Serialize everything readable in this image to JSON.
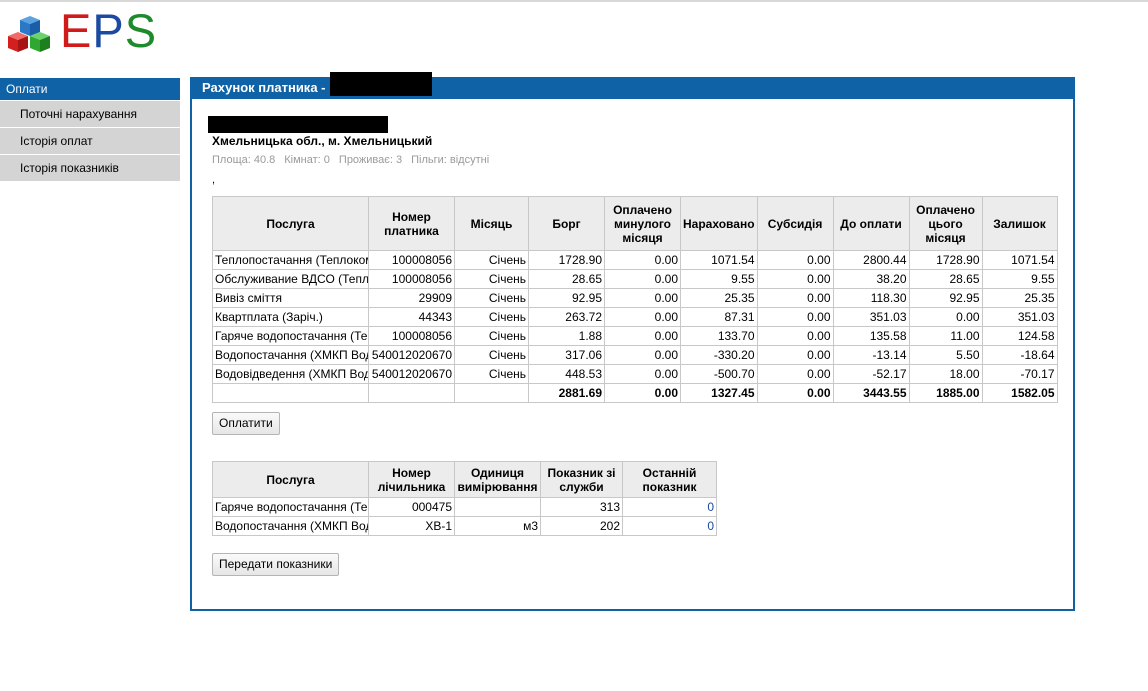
{
  "logo": {
    "letters": [
      "E",
      "P",
      "S"
    ]
  },
  "sidebar": {
    "header": "Оплати",
    "items": [
      {
        "label": "Поточні нарахування"
      },
      {
        "label": "Історія оплат"
      },
      {
        "label": "Історія показників"
      }
    ]
  },
  "panel": {
    "title": "Рахунок платника -",
    "address": "Хмельницька обл., м. Хмельницький",
    "meta": [
      "Площа: 40.8",
      "Кімнат: 0",
      "Проживає: 3",
      "Пільги: відсутні"
    ],
    "dot": ","
  },
  "charges": {
    "headers": [
      "Послуга",
      "Номер платника",
      "Місяць",
      "Борг",
      "Оплачено минулого місяця",
      "Нараховано",
      "Субсидія",
      "До оплати",
      "Оплачено цього місяця",
      "Залишок"
    ],
    "rows": [
      [
        "Теплопостачання (Теплокомуненерго)",
        "100008056",
        "Січень",
        "1728.90",
        "0.00",
        "1071.54",
        "0.00",
        "2800.44",
        "1728.90",
        "1071.54"
      ],
      [
        "Обслуживание ВДСО (Теплокомуненерго)",
        "100008056",
        "Січень",
        "28.65",
        "0.00",
        "9.55",
        "0.00",
        "38.20",
        "28.65",
        "9.55"
      ],
      [
        "Вивіз сміття",
        "29909",
        "Січень",
        "92.95",
        "0.00",
        "25.35",
        "0.00",
        "118.30",
        "92.95",
        "25.35"
      ],
      [
        "Квартплата (Заріч.)",
        "44343",
        "Січень",
        "263.72",
        "0.00",
        "87.31",
        "0.00",
        "351.03",
        "0.00",
        "351.03"
      ],
      [
        "Гаряче водопостачання (Теплокомуненерго)",
        "100008056",
        "Січень",
        "1.88",
        "0.00",
        "133.70",
        "0.00",
        "135.58",
        "11.00",
        "124.58"
      ],
      [
        "Водопостачання (ХМКП Водоканал)",
        "540012020670",
        "Січень",
        "317.06",
        "0.00",
        "-330.20",
        "0.00",
        "-13.14",
        "5.50",
        "-18.64"
      ],
      [
        "Водовідведення (ХМКП Водоканал)",
        "540012020670",
        "Січень",
        "448.53",
        "0.00",
        "-500.70",
        "0.00",
        "-52.17",
        "18.00",
        "-70.17"
      ]
    ],
    "totals": [
      "",
      "",
      "",
      "2881.69",
      "0.00",
      "1327.45",
      "0.00",
      "3443.55",
      "1885.00",
      "1582.05"
    ],
    "pay_button": "Оплатити"
  },
  "meters": {
    "headers": [
      "Послуга",
      "Номер лічильника",
      "Одиниця вимірювання",
      "Показник зі служби",
      "Останній показник"
    ],
    "rows": [
      [
        "Гаряче водопостачання (Теплокомуненерго)",
        "000475",
        "",
        "313",
        "0"
      ],
      [
        "Водопостачання (ХМКП Водоканал)",
        "ХВ-1",
        "м3",
        "202",
        "0"
      ]
    ],
    "send_button": "Передати показники"
  }
}
